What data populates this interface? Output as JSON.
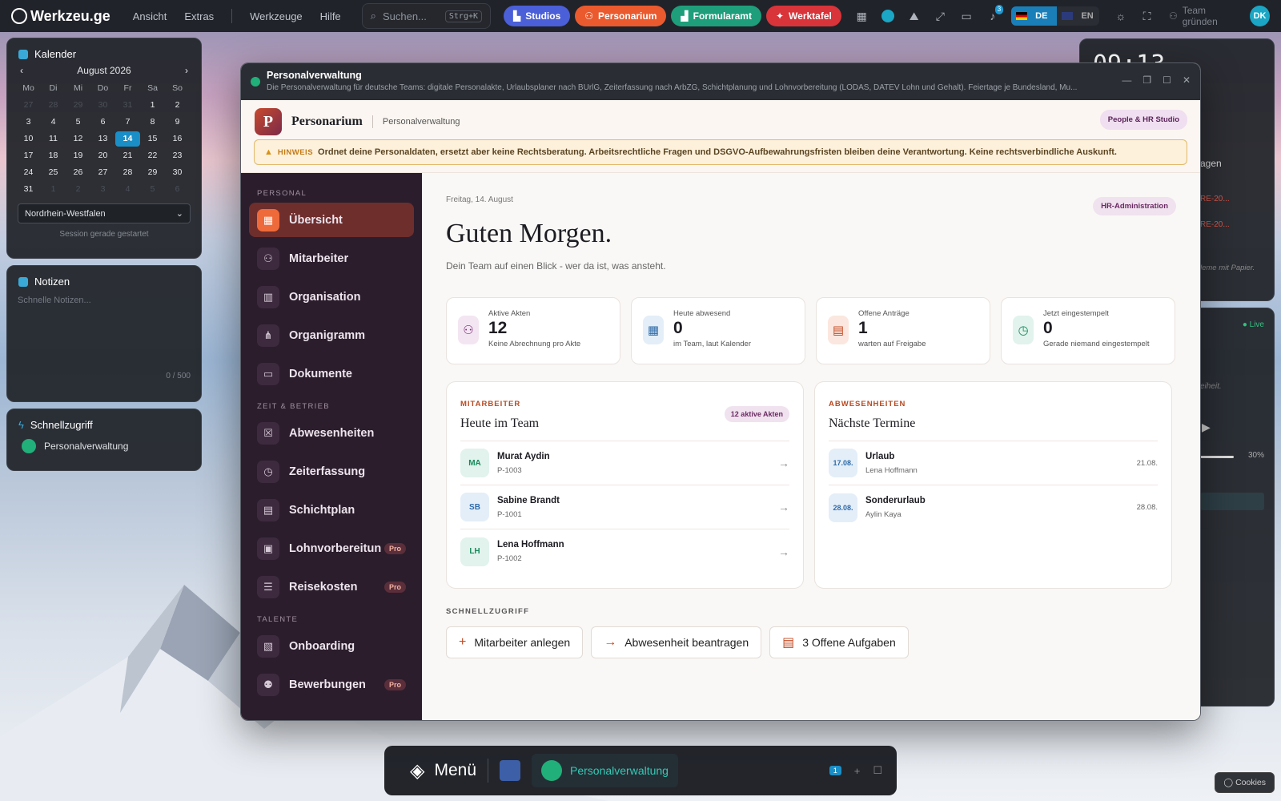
{
  "topbar": {
    "brand": "Werkzeu.ge",
    "menu": [
      "Ansicht",
      "Extras",
      "Werkzeuge",
      "Hilfe"
    ],
    "search_placeholder": "Suchen...",
    "search_shortcut": "Strg+K",
    "pills": [
      {
        "label": "Studios",
        "color": "#4a5fd8"
      },
      {
        "label": "Personarium",
        "color": "#ea5a2e"
      },
      {
        "label": "Formularamt",
        "color": "#1e9e7a"
      },
      {
        "label": "Werktafel",
        "color": "#d8343a"
      }
    ],
    "notifications": "3",
    "lang_de": "DE",
    "lang_en": "EN",
    "team_label": "Team gründen",
    "avatar": "DK"
  },
  "calendar": {
    "title": "Kalender",
    "month": "August 2026",
    "dow": [
      "Mo",
      "Di",
      "Mi",
      "Do",
      "Fr",
      "Sa",
      "So"
    ],
    "days": [
      "27",
      "28",
      "29",
      "30",
      "31",
      "1",
      "2",
      "3",
      "4",
      "5",
      "6",
      "7",
      "8",
      "9",
      "10",
      "11",
      "12",
      "13",
      "14",
      "15",
      "16",
      "17",
      "18",
      "19",
      "20",
      "21",
      "22",
      "23",
      "24",
      "25",
      "26",
      "27",
      "28",
      "29",
      "30",
      "31",
      "1",
      "2",
      "3",
      "4",
      "5",
      "6"
    ],
    "today": "14",
    "region": "Nordrhein-Westfalen",
    "session": "Session gerade gestartet"
  },
  "notes": {
    "title": "Notizen",
    "placeholder": "Schnelle Notizen...",
    "count": "0 / 500"
  },
  "quick": {
    "title": "Schnellzugriff",
    "item": "Personalverwaltung"
  },
  "clock": {
    "time": "09:13"
  },
  "right": {
    "fragen": "agen",
    "err1": "RE-20...",
    "err2": "RE-20...",
    "papier": "leme mit Papier.",
    "live": "Live",
    "heit": "eiheit.",
    "pct": "30%"
  },
  "window": {
    "title": "Personalverwaltung",
    "subtitle": "Die Personalverwaltung für deutsche Teams: digitale Personalakte, Urlaubsplaner nach BUrlG, Zeiterfassung nach ArbZG, Schichtplanung und Lohnvorbereitung (LODAS, DATEV Lohn und Gehalt). Feiertage je Bundesland, Mu..."
  },
  "app": {
    "logo": "P",
    "name": "Personarium",
    "section": "Personalverwaltung",
    "studio": "People & HR Studio",
    "notice_tag": "HINWEIS",
    "notice": "Ordnet deine Personaldaten, ersetzt aber keine Rechtsberatung. Arbeitsrechtliche Fragen und DSGVO-Aufbewahrungsfristen bleiben deine Verantwortung. Keine rechtsverbindliche Auskunft."
  },
  "sidebar": {
    "sec1": "PERSONAL",
    "sec2": "ZEIT & BETRIEB",
    "sec3": "TALENTE",
    "items": [
      {
        "label": "Übersicht",
        "icon": "▦"
      },
      {
        "label": "Mitarbeiter",
        "icon": "⚇"
      },
      {
        "label": "Organisation",
        "icon": "▥"
      },
      {
        "label": "Organigramm",
        "icon": "⋔"
      },
      {
        "label": "Dokumente",
        "icon": "▭"
      },
      {
        "label": "Abwesenheiten",
        "icon": "☒"
      },
      {
        "label": "Zeiterfassung",
        "icon": "◷"
      },
      {
        "label": "Schichtplan",
        "icon": "▤"
      },
      {
        "label": "Lohnvorbereitun",
        "icon": "▣",
        "pro": "Pro"
      },
      {
        "label": "Reisekosten",
        "icon": "☰",
        "pro": "Pro"
      },
      {
        "label": "Onboarding",
        "icon": "▧"
      },
      {
        "label": "Bewerbungen",
        "icon": "⚉",
        "pro": "Pro"
      }
    ]
  },
  "main": {
    "date": "Freitag, 14. August",
    "role": "HR-Administration",
    "greeting": "Guten Morgen.",
    "lead": "Dein Team auf einen Blick - wer da ist, was ansteht.",
    "stats": [
      {
        "label": "Aktive Akten",
        "value": "12",
        "sub": "Keine Abrechnung pro Akte",
        "icon": "⚇",
        "bg": "#f3e6f2",
        "fg": "#7a2a74"
      },
      {
        "label": "Heute abwesend",
        "value": "0",
        "sub": "im Team, laut Kalender",
        "icon": "▦",
        "bg": "#e4eef8",
        "fg": "#2e6aa8"
      },
      {
        "label": "Offene Anträge",
        "value": "1",
        "sub": "warten auf Freigabe",
        "icon": "▤",
        "bg": "#fbe7df",
        "fg": "#c2481e"
      },
      {
        "label": "Jetzt eingestempelt",
        "value": "0",
        "sub": "Gerade niemand eingestempelt",
        "icon": "◷",
        "bg": "#e1f3ec",
        "fg": "#178a5c"
      }
    ],
    "team": {
      "kicker": "MITARBEITER",
      "title": "Heute im Team",
      "badge": "12 aktive Akten",
      "rows": [
        {
          "ini": "MA",
          "name": "Murat Aydin",
          "id": "P-1003",
          "bg": "#e1f3ec",
          "fg": "#178a5c"
        },
        {
          "ini": "SB",
          "name": "Sabine Brandt",
          "id": "P-1001",
          "bg": "#e4eef8",
          "fg": "#2e6aa8"
        },
        {
          "ini": "LH",
          "name": "Lena Hoffmann",
          "id": "P-1002",
          "bg": "#e1f3ec",
          "fg": "#178a5c"
        }
      ]
    },
    "abs": {
      "kicker": "ABWESENHEITEN",
      "title": "Nächste Termine",
      "rows": [
        {
          "date": "17.08.",
          "type": "Urlaub",
          "name": "Lena Hoffmann",
          "end": "21.08."
        },
        {
          "date": "28.08.",
          "type": "Sonderurlaub",
          "name": "Aylin Kaya",
          "end": "28.08."
        }
      ]
    },
    "quick_label": "SCHNELLZUGRIFF",
    "quick": [
      {
        "icon": "+",
        "label": "Mitarbeiter anlegen"
      },
      {
        "icon": "→",
        "label": "Abwesenheit beantragen"
      },
      {
        "icon": "▤",
        "label": "3 Offene Aufgaben"
      }
    ]
  },
  "dock": {
    "menu": "Menü",
    "app": "Personalverwaltung",
    "count": "1"
  },
  "cookies": "Cookies"
}
